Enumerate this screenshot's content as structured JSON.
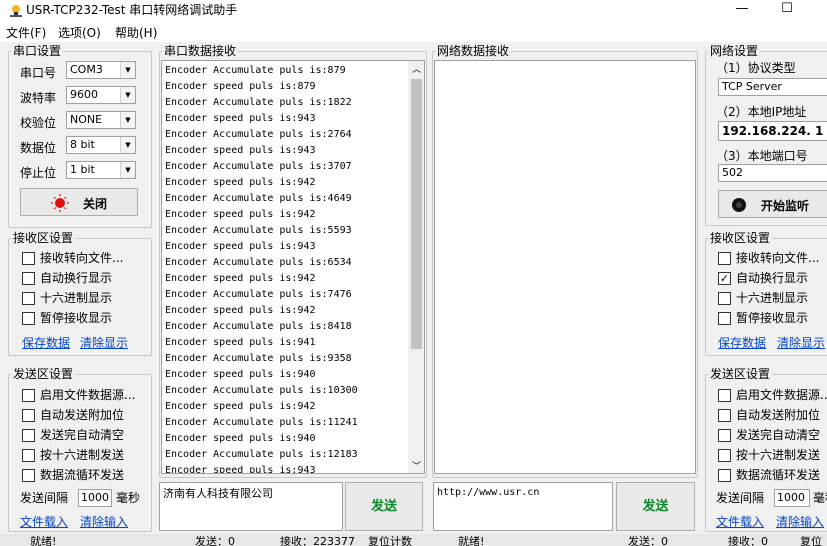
{
  "window": {
    "title": "USR-TCP232-Test 串口转网络调试助手",
    "minimize": "—",
    "maximize": "☐"
  },
  "menu": {
    "file": "文件(F)",
    "options": "选项(O)",
    "help": "帮助(H)"
  },
  "serial": {
    "legend": "串口设置",
    "port_label": "串口号",
    "port_value": "COM3",
    "baud_label": "波特率",
    "baud_value": "9600",
    "parity_label": "校验位",
    "parity_value": "NONE",
    "databits_label": "数据位",
    "databits_value": "8 bit",
    "stopbits_label": "停止位",
    "stopbits_value": "1 bit",
    "close_button": "关闭"
  },
  "serial_recv": {
    "legend": "接收区设置",
    "options": [
      {
        "label": "接收转向文件...",
        "checked": false
      },
      {
        "label": "自动换行显示",
        "checked": false
      },
      {
        "label": "十六进制显示",
        "checked": false
      },
      {
        "label": "暂停接收显示",
        "checked": false
      }
    ],
    "save_link": "保存数据",
    "clear_link": "清除显示"
  },
  "serial_send": {
    "legend": "发送区设置",
    "options": [
      {
        "label": "启用文件数据源...",
        "checked": false
      },
      {
        "label": "自动发送附加位",
        "checked": false
      },
      {
        "label": "发送完自动清空",
        "checked": false
      },
      {
        "label": "按十六进制发送",
        "checked": false
      },
      {
        "label": "数据流循环发送",
        "checked": false
      }
    ],
    "interval_label": "发送间隔",
    "interval_value": "1000",
    "interval_unit": "毫秒",
    "load_link": "文件载入",
    "clear_link": "清除输入"
  },
  "serial_data": {
    "legend": "串口数据接收",
    "lines": [
      "Encoder Accumulate puls is:879",
      "Encoder speed puls is:879",
      "Encoder Accumulate puls is:1822",
      "Encoder speed puls is:943",
      "Encoder Accumulate puls is:2764",
      "Encoder speed puls is:943",
      "Encoder Accumulate puls is:3707",
      "Encoder speed puls is:942",
      "Encoder Accumulate puls is:4649",
      "Encoder speed puls is:942",
      "Encoder Accumulate puls is:5593",
      "Encoder speed puls is:943",
      "Encoder Accumulate puls is:6534",
      "Encoder speed puls is:942",
      "Encoder Accumulate puls is:7476",
      "Encoder speed puls is:942",
      "Encoder Accumulate puls is:8418",
      "Encoder speed puls is:941",
      "Encoder Accumulate puls is:9358",
      "Encoder speed puls is:940",
      "Encoder Accumulate puls is:10300",
      "Encoder speed puls is:942",
      "Encoder Accumulate puls is:11241",
      "Encoder speed puls is:940",
      "Encoder Accumulate puls is:12183",
      "Encoder speed puls is:943"
    ],
    "send_text": "济南有人科技有限公司",
    "send_button": "发送"
  },
  "net_data": {
    "legend": "网络数据接收",
    "send_text": "http://www.usr.cn",
    "send_button": "发送"
  },
  "net": {
    "legend": "网络设置",
    "protocol_label": "（1）协议类型",
    "protocol_value": "TCP Server",
    "ip_label": "（2）本地IP地址",
    "ip_value": "192.168.224. 1",
    "port_label": "（3）本地端口号",
    "port_value": "502",
    "listen_button": "开始监听"
  },
  "net_recv": {
    "legend": "接收区设置",
    "options": [
      {
        "label": "接收转向文件...",
        "checked": false
      },
      {
        "label": "自动换行显示",
        "checked": true
      },
      {
        "label": "十六进制显示",
        "checked": false
      },
      {
        "label": "暂停接收显示",
        "checked": false
      }
    ],
    "save_link": "保存数据",
    "clear_link": "清除显示"
  },
  "net_send": {
    "legend": "发送区设置",
    "options": [
      {
        "label": "启用文件数据源...",
        "checked": false
      },
      {
        "label": "自动发送附加位",
        "checked": false
      },
      {
        "label": "发送完自动清空",
        "checked": false
      },
      {
        "label": "按十六进制发送",
        "checked": false
      },
      {
        "label": "数据流循环发送",
        "checked": false
      }
    ],
    "interval_label": "发送间隔",
    "interval_value": "1000",
    "interval_unit": "毫秒",
    "load_link": "文件载入",
    "clear_link": "清除输入"
  },
  "status": {
    "ready": "就绪!",
    "serial_sent": "发送：0",
    "serial_recv": "接收：223377",
    "reset": "复位计数",
    "net_ready": "就绪!",
    "net_sent": "发送：0",
    "net_recv": "接收：0",
    "net_reset": "复位"
  }
}
